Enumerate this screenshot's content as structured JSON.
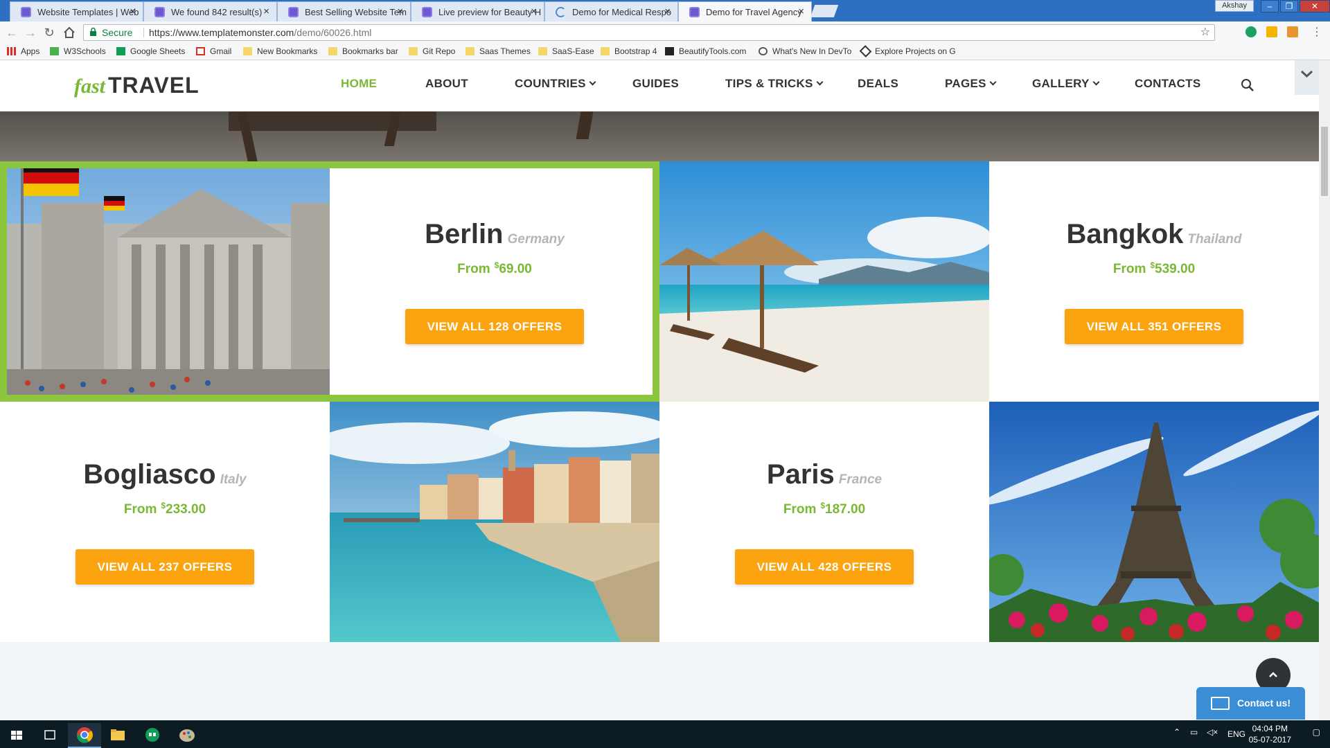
{
  "browser": {
    "tabs": [
      {
        "title": "Website Templates | Web",
        "active": false
      },
      {
        "title": "We found 842 result(s)",
        "active": false
      },
      {
        "title": "Best Selling Website Tem",
        "active": false
      },
      {
        "title": "Live preview for Beauty H",
        "active": false
      },
      {
        "title": "Demo for Medical Respo",
        "active": false
      },
      {
        "title": "Demo for Travel Agency",
        "active": true
      }
    ],
    "profile_name": "Akshay",
    "secure_label": "Secure",
    "url_host": "https://www.templatemonster.com",
    "url_path": "/demo/60026.html",
    "bookmarks": [
      "Apps",
      "W3Schools",
      "Google Sheets",
      "Gmail",
      "New Bookmarks",
      "Bookmarks bar",
      "Git Repo",
      "Saas Themes",
      "SaaS-Ease",
      "Bootstrap 4",
      "BeautifyTools.com",
      "What's New In DevTo",
      "Explore Projects on G"
    ]
  },
  "site": {
    "logo_fast": "fast",
    "logo_travel": "TRAVEL",
    "nav": [
      "HOME",
      "ABOUT",
      "COUNTRIES",
      "GUIDES",
      "TIPS & TRICKS",
      "DEALS",
      "PAGES",
      "GALLERY",
      "CONTACTS"
    ],
    "accent_color": "#7ab833",
    "button_color": "#fca310"
  },
  "destinations": [
    {
      "city": "Berlin",
      "country": "Germany",
      "from_label": "From",
      "currency": "$",
      "price": "69.00",
      "button": "VIEW ALL 128 OFFERS",
      "image": "reichstag-photo"
    },
    {
      "city": "Bangkok",
      "country": "Thailand",
      "from_label": "From",
      "currency": "$",
      "price": "539.00",
      "button": "VIEW ALL 351 OFFERS",
      "image": "beach-umbrellas-photo"
    },
    {
      "city": "Bogliasco",
      "country": "Italy",
      "from_label": "From",
      "currency": "$",
      "price": "233.00",
      "button": "VIEW ALL 237 OFFERS",
      "image": "coastal-town-photo"
    },
    {
      "city": "Paris",
      "country": "France",
      "from_label": "From",
      "currency": "$",
      "price": "187.00",
      "button": "VIEW ALL 428 OFFERS",
      "image": "eiffel-tower-photo"
    }
  ],
  "widgets": {
    "contact_label": "Contact us!"
  },
  "taskbar": {
    "language": "ENG",
    "time": "04:04 PM",
    "date": "05-07-2017"
  }
}
